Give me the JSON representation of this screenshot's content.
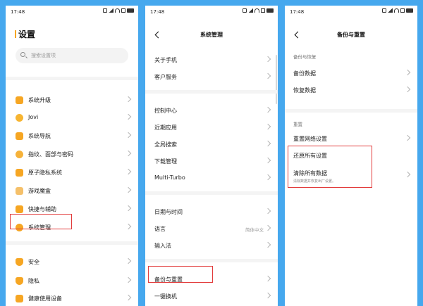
{
  "status_time": "17:48",
  "panel1": {
    "title": "设置",
    "search_placeholder": "搜索设置项",
    "items": [
      {
        "label": "系统升级",
        "icon": "upgrade-icon",
        "color": "#f6a623"
      },
      {
        "label": "Jovi",
        "icon": "jovi-icon",
        "color": "#f7b532"
      },
      {
        "label": "系统导航",
        "icon": "navigation-icon",
        "color": "#f6a623"
      },
      {
        "label": "指纹、面部与密码",
        "icon": "fingerprint-icon",
        "color": "#f6b23a"
      },
      {
        "label": "原子隐私系统",
        "icon": "privacy-system-icon",
        "color": "#f6a623"
      },
      {
        "label": "游戏魔盒",
        "icon": "game-box-icon",
        "color": "#f5c06a"
      },
      {
        "label": "快捷与辅助",
        "icon": "shortcut-icon",
        "color": "#f6a623"
      },
      {
        "label": "系统管理",
        "icon": "system-management-icon",
        "color": "#f6a623"
      },
      {
        "label": "安全",
        "icon": "security-icon",
        "color": "#f6a623"
      },
      {
        "label": "隐私",
        "icon": "privacy-icon",
        "color": "#f6a623"
      },
      {
        "label": "健康使用设备",
        "icon": "health-usage-icon",
        "color": "#f6a623"
      }
    ]
  },
  "panel2": {
    "title": "系统管理",
    "items": [
      {
        "label": "关于手机"
      },
      {
        "label": "客户服务"
      },
      {
        "label": "控制中心"
      },
      {
        "label": "近期应用"
      },
      {
        "label": "全局搜索"
      },
      {
        "label": "下载管理"
      },
      {
        "label": "Multi-Turbo"
      },
      {
        "label": "日期与时间"
      },
      {
        "label": "语言",
        "value": "简体中文"
      },
      {
        "label": "输入法"
      },
      {
        "label": "备份与重置"
      },
      {
        "label": "一键换机"
      }
    ]
  },
  "panel3": {
    "title": "备份与重置",
    "section1": "备份与恢复",
    "section2": "重置",
    "items": [
      {
        "label": "备份数据"
      },
      {
        "label": "恢复数据"
      },
      {
        "label": "重置网络设置"
      },
      {
        "label": "还原所有设置"
      },
      {
        "label": "清除所有数据",
        "sub": "清除数据并恢复出厂设置。"
      }
    ]
  },
  "colors": {
    "background": "#46a8ee",
    "accent": "#f6a623",
    "highlight": "#e23c3c"
  }
}
